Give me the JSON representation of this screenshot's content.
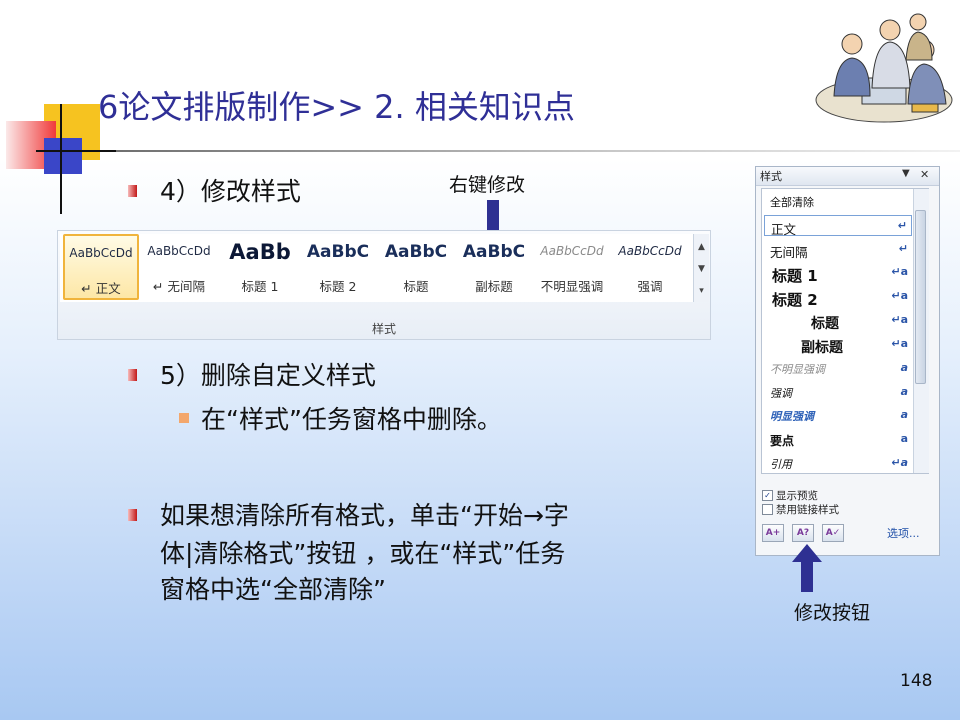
{
  "slide": {
    "title": "6论文排版制作>> 2. 相关知识点",
    "page_number": "148"
  },
  "bullets": {
    "b1": "4）修改样式",
    "b2": "5）删除自定义样式",
    "b2_sub": "在“样式”任务窗格中删除。",
    "b3_line1": "如果想清除所有格式，单击“开始→字",
    "b3_line2": "体|清除格式”按钮 ，或在“样式”任务",
    "b3_line3": "窗格中选“全部清除”"
  },
  "callouts": {
    "right_click": "右键修改",
    "modify_button": "修改按钮"
  },
  "ribbon": {
    "group_label": "样式",
    "styles": [
      {
        "preview": "AaBbCcDd",
        "name": "↵ 正文"
      },
      {
        "preview": "AaBbCcDd",
        "name": "↵ 无间隔"
      },
      {
        "preview": "AaBb",
        "name": "标题 1"
      },
      {
        "preview": "AaBbC",
        "name": "标题 2"
      },
      {
        "preview": "AaBbC",
        "name": "标题"
      },
      {
        "preview": "AaBbC",
        "name": "副标题"
      },
      {
        "preview": "AaBbCcDd",
        "name": "不明显强调"
      },
      {
        "preview": "AaBbCcDd",
        "name": "强调"
      }
    ]
  },
  "styles_pane": {
    "title": "样式",
    "items": [
      {
        "label": "全部清除",
        "sym": ""
      },
      {
        "label": "正文",
        "sym": "↵"
      },
      {
        "label": "无间隔",
        "sym": "↵"
      },
      {
        "label": "标题 1",
        "sym": "↵a"
      },
      {
        "label": "标题 2",
        "sym": "↵a"
      },
      {
        "label": "标题",
        "sym": "↵a"
      },
      {
        "label": "副标题",
        "sym": "↵a"
      },
      {
        "label": "不明显强调",
        "sym": "a"
      },
      {
        "label": "强调",
        "sym": "a"
      },
      {
        "label": "明显强调",
        "sym": "a"
      },
      {
        "label": "要点",
        "sym": "a"
      },
      {
        "label": "引用",
        "sym": "↵a"
      }
    ],
    "show_preview_label": "显示预览",
    "disable_linked_label": "禁用链接样式",
    "options_label": "选项..."
  }
}
